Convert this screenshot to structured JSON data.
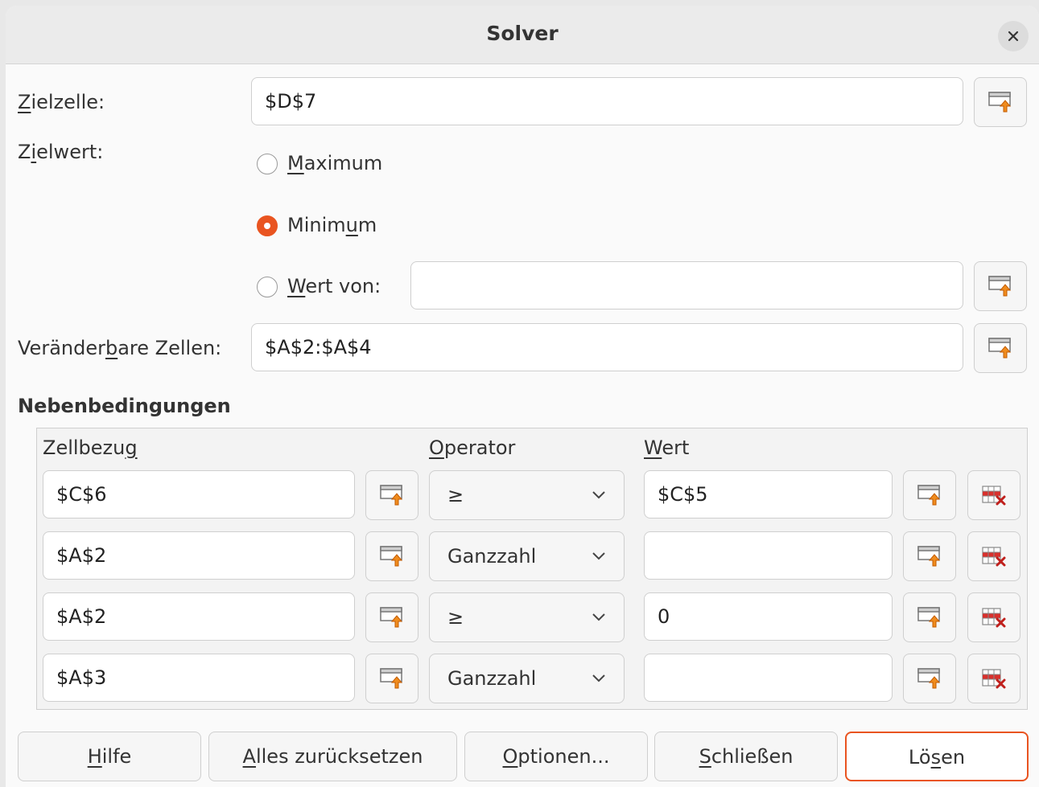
{
  "window": {
    "title": "Solver"
  },
  "target": {
    "label_pre": "",
    "label_key": "Z",
    "label_post": "ielzelle:",
    "value": "$D$7"
  },
  "goal": {
    "label_pre": "Z",
    "label_key": "i",
    "label_post": "elwert:",
    "options": [
      {
        "pre": "",
        "key": "M",
        "post": "aximum",
        "selected": false
      },
      {
        "pre": "Minim",
        "key": "u",
        "post": "m",
        "selected": true
      },
      {
        "pre": "",
        "key": "W",
        "post": "ert von:",
        "selected": false
      }
    ],
    "value_of": ""
  },
  "variable": {
    "label_pre": "Veränder",
    "label_key": "b",
    "label_post": "are Zellen:",
    "value": "$A$2:$A$4"
  },
  "constraints": {
    "heading": "Nebenbedingungen",
    "col_cell_pre": "Zellbezu",
    "col_cell_key": "g",
    "col_cell_post": "",
    "col_op_pre": "",
    "col_op_key": "O",
    "col_op_post": "perator",
    "col_val_pre": "",
    "col_val_key": "W",
    "col_val_post": "ert",
    "rows": [
      {
        "cell": "$C$6",
        "operator": "≥",
        "value": "$C$5"
      },
      {
        "cell": "$A$2",
        "operator": "Ganzzahl",
        "value": ""
      },
      {
        "cell": "$A$2",
        "operator": "≥",
        "value": "0"
      },
      {
        "cell": "$A$3",
        "operator": "Ganzzahl",
        "value": ""
      }
    ]
  },
  "buttons": {
    "help_pre": "",
    "help_key": "H",
    "help_post": "ilfe",
    "reset_pre": "",
    "reset_key": "A",
    "reset_post": "lles zurücksetzen",
    "options_pre": "",
    "options_key": "O",
    "options_post": "ptionen...",
    "close_pre": "",
    "close_key": "S",
    "close_post": "chließen",
    "solve_pre": "Lö",
    "solve_key": "s",
    "solve_post": "en"
  },
  "colors": {
    "accent": "#e95420",
    "titlebar": "#ebebeb",
    "background": "#fafafa"
  },
  "icons": {
    "shrink": "shrink-range-icon",
    "delete": "delete-row-icon",
    "close": "close-icon",
    "dropdown": "chevron-down-icon"
  }
}
